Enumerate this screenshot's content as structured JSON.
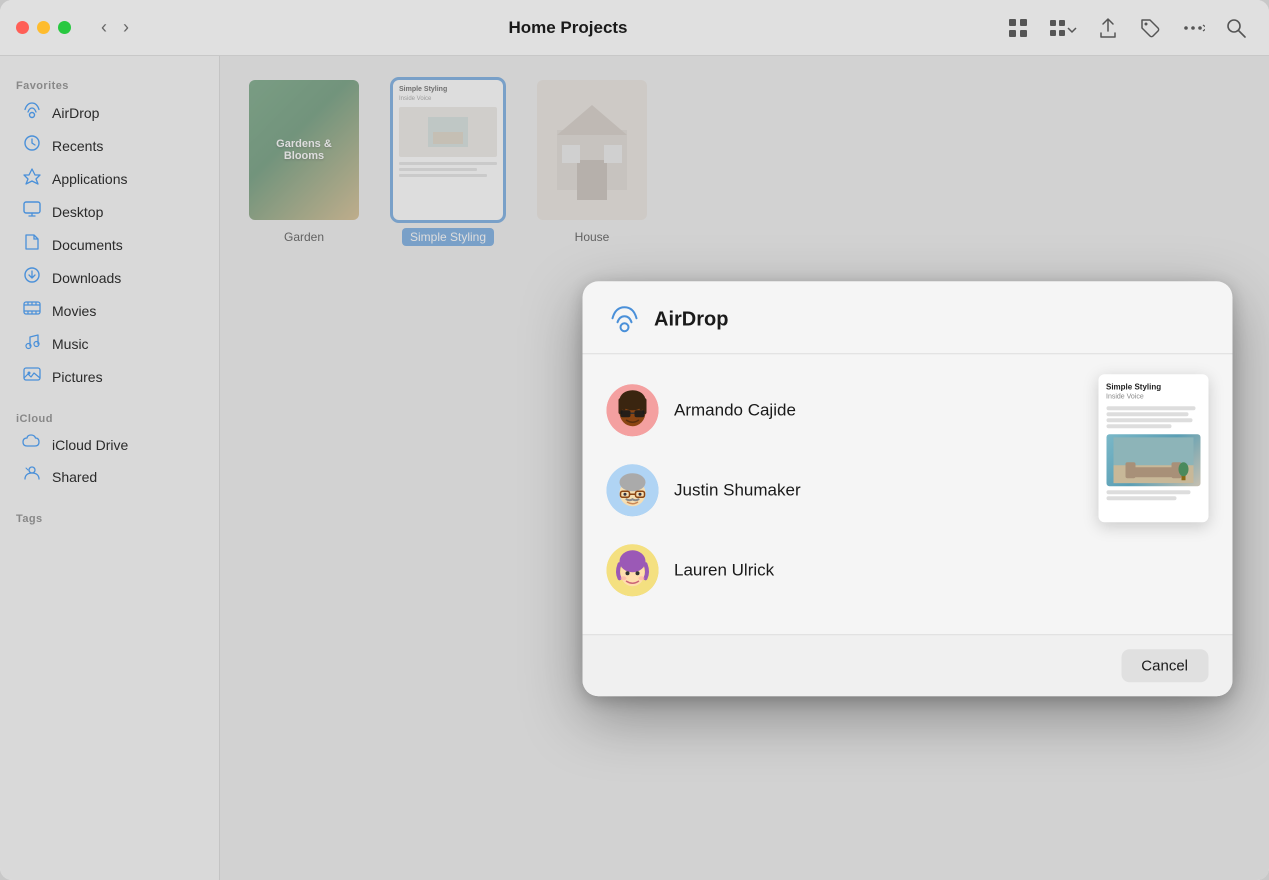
{
  "window": {
    "title": "Home Projects",
    "controls": {
      "close": "close",
      "minimize": "minimize",
      "maximize": "maximize"
    }
  },
  "sidebar": {
    "sections": [
      {
        "label": "Favorites",
        "items": [
          {
            "id": "airdrop",
            "icon": "airdrop",
            "label": "AirDrop"
          },
          {
            "id": "recents",
            "icon": "recents",
            "label": "Recents"
          },
          {
            "id": "applications",
            "icon": "applications",
            "label": "Applications"
          },
          {
            "id": "desktop",
            "icon": "desktop",
            "label": "Desktop"
          },
          {
            "id": "documents",
            "icon": "documents",
            "label": "Documents"
          },
          {
            "id": "downloads",
            "icon": "downloads",
            "label": "Downloads"
          },
          {
            "id": "movies",
            "icon": "movies",
            "label": "Movies"
          },
          {
            "id": "music",
            "icon": "music",
            "label": "Music"
          },
          {
            "id": "pictures",
            "icon": "pictures",
            "label": "Pictures"
          }
        ]
      },
      {
        "label": "iCloud",
        "items": [
          {
            "id": "icloud-drive",
            "icon": "icloud",
            "label": "iCloud Drive"
          },
          {
            "id": "shared",
            "icon": "shared",
            "label": "Shared"
          }
        ]
      },
      {
        "label": "Tags",
        "items": []
      }
    ]
  },
  "files": [
    {
      "id": "garden",
      "label": "Garden",
      "selected": false,
      "type": "garden"
    },
    {
      "id": "simple-styling",
      "label": "Simple Styling",
      "selected": true,
      "type": "styling"
    },
    {
      "id": "house",
      "label": "House",
      "selected": false,
      "type": "house"
    }
  ],
  "dialog": {
    "title": "AirDrop",
    "contacts": [
      {
        "id": "armando",
        "name": "Armando Cajide",
        "avatar_type": "armando",
        "emoji": "🧑"
      },
      {
        "id": "justin",
        "name": "Justin Shumaker",
        "avatar_type": "justin",
        "emoji": "🧑"
      },
      {
        "id": "lauren",
        "name": "Lauren Ulrick",
        "avatar_type": "lauren",
        "emoji": "👩"
      }
    ],
    "cancel_label": "Cancel",
    "doc_preview": {
      "title": "Simple Styling",
      "subtitle": "Inside Voice"
    }
  }
}
